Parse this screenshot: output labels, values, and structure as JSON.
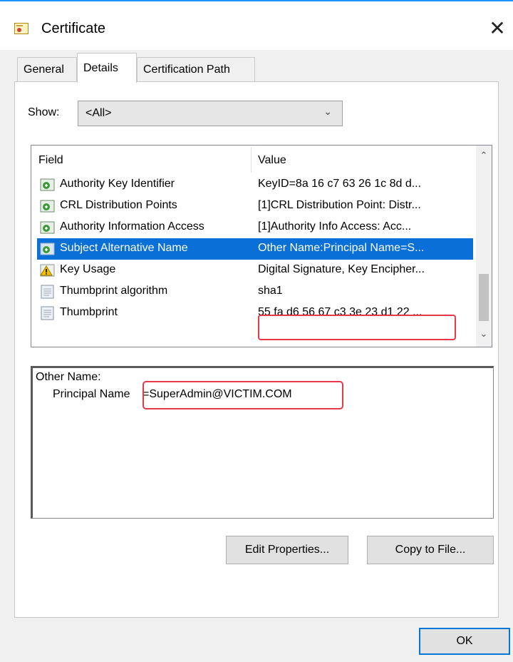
{
  "window": {
    "title": "Certificate",
    "close_glyph": "✕"
  },
  "tabs": [
    {
      "label": "General",
      "active": false
    },
    {
      "label": "Details",
      "active": true
    },
    {
      "label": "Certification Path",
      "active": false
    }
  ],
  "show": {
    "label": "Show:",
    "value": "<All>"
  },
  "list": {
    "headers": {
      "field": "Field",
      "value": "Value"
    },
    "rows": [
      {
        "field": "Authority Key Identifier",
        "value": "KeyID=8a 16 c7 63 26 1c 8d d...",
        "icon": "cert-extension-icon",
        "selected": false
      },
      {
        "field": "CRL Distribution Points",
        "value": "[1]CRL Distribution Point: Distr...",
        "icon": "cert-extension-icon",
        "selected": false
      },
      {
        "field": "Authority Information Access",
        "value": "[1]Authority Info Access: Acc...",
        "icon": "cert-extension-icon",
        "selected": false
      },
      {
        "field": "Subject Alternative Name",
        "value": "Other Name:Principal Name=S...",
        "icon": "cert-extension-icon",
        "selected": true
      },
      {
        "field": "Key Usage",
        "value": "Digital Signature, Key Encipher...",
        "icon": "warning-icon",
        "selected": false
      },
      {
        "field": "Thumbprint algorithm",
        "value": "sha1",
        "icon": "document-icon",
        "selected": false
      },
      {
        "field": "Thumbprint",
        "value": "55 fa d6 56 67 c3 3e 23 d1 22 ...",
        "icon": "document-icon",
        "selected": false
      }
    ]
  },
  "detail": {
    "line1": "Other Name:",
    "principal_label": "Principal Name",
    "principal_value": "=SuperAdmin@VICTIM.COM"
  },
  "buttons": {
    "edit_properties": "Edit Properties...",
    "copy_to_file": "Copy to File...",
    "ok": "OK"
  },
  "colors": {
    "selection": "#0a6fd6",
    "highlight_box": "#e8394a",
    "ok_border": "#0078d7"
  }
}
